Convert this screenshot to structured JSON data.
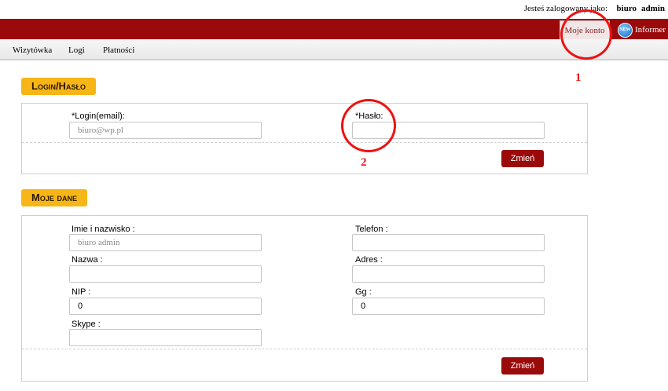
{
  "header": {
    "status_prefix": "Jesteś zalogowany jako:",
    "user_first": "biuro",
    "user_last": "admin",
    "tabs": [
      {
        "label": "Moje konto"
      },
      {
        "label": "Informer",
        "badge": "NEW"
      }
    ]
  },
  "nav": {
    "items": [
      "Wizytówka",
      "Logi",
      "Płatności"
    ]
  },
  "login_section": {
    "title": "Login/Hasło",
    "login_label": "*Login(email):",
    "login_value": "biuro@wp.pl",
    "password_label": "*Hasło:",
    "password_value": "",
    "submit_label": "Zmień"
  },
  "data_section": {
    "title": "Moje dane",
    "fields": {
      "name_label": "Imie i nazwisko :",
      "name_value": "biuro    admin",
      "phone_label": "Telefon :",
      "phone_value": "",
      "company_label": "Nazwa :",
      "company_value": "",
      "address_label": "Adres :",
      "address_value": "",
      "nip_label": "NIP :",
      "nip_value": "0",
      "gg_label": "Gg :",
      "gg_value": "0",
      "skype_label": "Skype :",
      "skype_value": ""
    },
    "submit_label": "Zmień"
  },
  "annotations": [
    "1",
    "2"
  ],
  "colors": {
    "brand_red": "#9b0a0a",
    "badge_yellow": "#f7b617",
    "annotation_red": "#e11111"
  }
}
